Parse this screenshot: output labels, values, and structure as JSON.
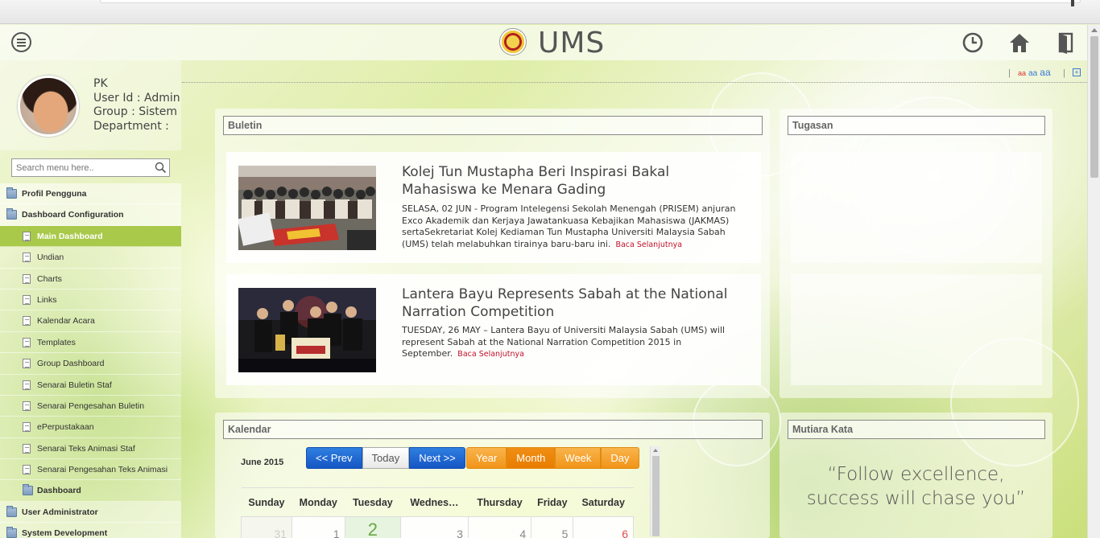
{
  "header": {
    "title": "UMS",
    "icons": [
      "menu-icon",
      "clock-icon",
      "home-icon",
      "logout-icon"
    ]
  },
  "profile": {
    "name": "PK",
    "user_id": "User Id : Admin",
    "group": "Group : Sistem",
    "department": "Department :"
  },
  "search": {
    "placeholder": "Search menu here.."
  },
  "menu": [
    {
      "label": "Profil Pengguna",
      "level": 0,
      "icon": "folder-icon"
    },
    {
      "label": "Dashboard Configuration",
      "level": 0,
      "icon": "folder-icon"
    },
    {
      "label": "Main Dashboard",
      "level": 1,
      "icon": "document-icon",
      "active": true
    },
    {
      "label": "Undian",
      "level": 1,
      "icon": "document-icon"
    },
    {
      "label": "Charts",
      "level": 1,
      "icon": "document-icon"
    },
    {
      "label": "Links",
      "level": 1,
      "icon": "document-icon"
    },
    {
      "label": "Kalendar Acara",
      "level": 1,
      "icon": "document-icon"
    },
    {
      "label": "Templates",
      "level": 1,
      "icon": "document-icon"
    },
    {
      "label": "Group Dashboard",
      "level": 1,
      "icon": "document-icon"
    },
    {
      "label": "Senarai Buletin Staf",
      "level": 1,
      "icon": "document-icon"
    },
    {
      "label": "Senarai Pengesahan Buletin",
      "level": 1,
      "icon": "document-icon"
    },
    {
      "label": "ePerpustakaan",
      "level": 1,
      "icon": "document-icon"
    },
    {
      "label": "Senarai Teks Animasi Staf",
      "level": 1,
      "icon": "document-icon"
    },
    {
      "label": "Senarai Pengesahan Teks Animasi",
      "level": 1,
      "icon": "document-icon"
    },
    {
      "label": "Dashboard",
      "level": 1,
      "icon": "folder-icon",
      "bold": true
    },
    {
      "label": "User Administrator",
      "level": 0,
      "icon": "folder-icon"
    },
    {
      "label": "System Development",
      "level": 0,
      "icon": "folder-icon"
    }
  ],
  "font_size_links": {
    "small": "aa",
    "medium": "aa",
    "large": "aa",
    "separator": "|"
  },
  "buletin": {
    "title": "Buletin",
    "items": [
      {
        "title": "Kolej Tun Mustapha Beri Inspirasi Bakal Mahasiswa ke Menara Gading",
        "body": "SELASA, 02 JUN - Program Intelegensi Sekolah Menengah (PRISEM) anjuran Exco Akademik dan Kerjaya Jawatankuasa Kebajikan Mahasiswa (JAKMAS) sertaSekretariat Kolej Kediaman Tun Mustapha Universiti Malaysia Sabah (UMS) telah melabuhkan tirainya baru-baru ini.",
        "read_more": "Baca Selanjutnya"
      },
      {
        "title": "Lantera Bayu Represents Sabah at the National Narration Competition",
        "body": "TUESDAY, 26 MAY – Lantera Bayu of Universiti Malaysia Sabah (UMS) will represent Sabah at the National Narration Competition 2015 in September.",
        "read_more": "Baca Selanjutnya"
      }
    ]
  },
  "tugasan": {
    "title": "Tugasan"
  },
  "kalendar": {
    "title": "Kalendar",
    "month": "June 2015",
    "nav_buttons": {
      "prev": "<< Prev",
      "today": "Today",
      "next": "Next >>"
    },
    "view_buttons": [
      "Year",
      "Month",
      "Week",
      "Day"
    ],
    "active_view": "Month",
    "weekdays": [
      "Sunday",
      "Monday",
      "Tuesday",
      "Wednes…",
      "Thursday",
      "Friday",
      "Saturday"
    ],
    "first_row": [
      "31",
      "1",
      "2",
      "3",
      "4",
      "5",
      "6"
    ],
    "today": "2"
  },
  "mutiara": {
    "title": "Mutiara Kata",
    "quote_line1": "“Follow excellence,",
    "quote_line2": "success will chase you”"
  },
  "colors": {
    "accent_green": "#a9c94a",
    "nav_blue": "#1a5fcf",
    "view_orange": "#f19418",
    "read_more_red": "#c0102a"
  }
}
